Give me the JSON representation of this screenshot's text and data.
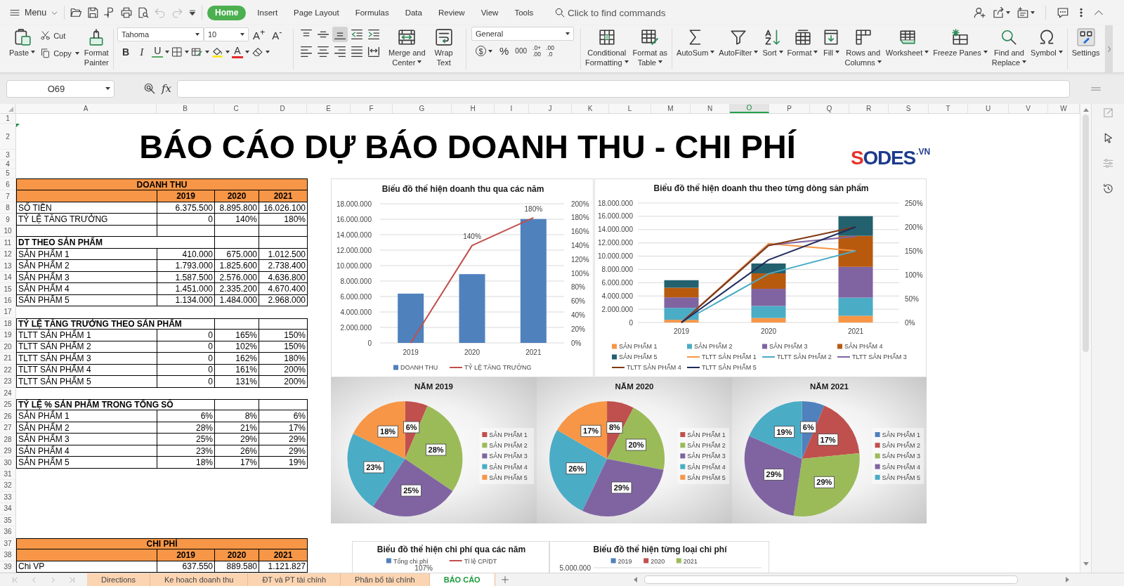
{
  "title_bar": {
    "menu": {
      "label": "Menu"
    },
    "quick_access": [
      {
        "disabled": false
      },
      {
        "disabled": false
      },
      {
        "disabled": false
      },
      {
        "disabled": false
      },
      {
        "disabled": false
      },
      {
        "disabled": true
      },
      {
        "disabled": true
      }
    ],
    "tabs": [
      {
        "label": "Home",
        "selected": true
      },
      {
        "label": "Insert",
        "selected": false
      },
      {
        "label": "Page Layout",
        "selected": false
      },
      {
        "label": "Formulas",
        "selected": false
      },
      {
        "label": "Data",
        "selected": false
      },
      {
        "label": "Review",
        "selected": false
      },
      {
        "label": "View",
        "selected": false
      },
      {
        "label": "Tools",
        "selected": false
      }
    ],
    "command_search": {
      "placeholder": "Click to find commands"
    }
  },
  "ribbon": {
    "paste": {
      "label": "Paste",
      "dropdown": true
    },
    "cut": {
      "label": "Cut"
    },
    "copy": {
      "label": "Copy",
      "dropdown": true
    },
    "format_painter": {
      "lines": [
        "Format",
        "Painter"
      ]
    },
    "font_name": {
      "value": "Tahoma"
    },
    "font_size": {
      "value": "10"
    },
    "font_grow": "A$^{+}$",
    "font_shrink": "A$^{-}$",
    "bold": "B",
    "italic": "I",
    "underline": "U",
    "font_color": "A",
    "vertical_alignment": [
      {
        "selected": false
      },
      {
        "selected": false
      },
      {
        "selected": true
      }
    ],
    "merge": [
      {
        "lines": [
          "Merge and",
          "Center"
        ],
        "dropdown": true
      },
      {
        "lines": [
          "Wrap",
          "Text"
        ],
        "dropdown": false
      }
    ],
    "number_format": {
      "value": "General"
    },
    "currency": "$",
    "percent": "%",
    "thousands": "000",
    "increase_decimal": [
      ".0+",
      ".00"
    ],
    "decrease_decimal": [
      ".00",
      ".0"
    ],
    "tools": [
      {
        "lines": [
          "Conditional",
          "Formatting"
        ],
        "dropdown": true
      },
      {
        "lines": [
          "Format as",
          "Table"
        ],
        "dropdown": true
      },
      {
        "lines": [
          "AutoSum"
        ],
        "dropdown": true
      },
      {
        "lines": [
          "AutoFilter"
        ],
        "dropdown": true
      },
      {
        "lines": [
          "Sort"
        ],
        "dropdown": true
      },
      {
        "lines": [
          "Format"
        ],
        "dropdown": true
      },
      {
        "lines": [
          "Fill"
        ],
        "dropdown": true
      },
      {
        "lines": [
          "Rows and",
          "Columns"
        ],
        "dropdown": true
      },
      {
        "lines": [
          "Worksheet"
        ],
        "dropdown": true
      },
      {
        "lines": [
          "Freeze Panes"
        ],
        "dropdown": true
      },
      {
        "lines": [
          "Find and",
          "Replace"
        ],
        "dropdown": true
      },
      {
        "lines": [
          "Symbol"
        ],
        "dropdown": true
      },
      {
        "lines": [
          "Settings"
        ],
        "dropdown": false
      }
    ]
  },
  "formula_bar": {
    "name_box": "O69",
    "function_label": "fx"
  },
  "column_headers": [
    {
      "label": "A",
      "selected": false
    },
    {
      "label": "B",
      "selected": false
    },
    {
      "label": "C",
      "selected": false
    },
    {
      "label": "D",
      "selected": false
    },
    {
      "label": "E",
      "selected": false
    },
    {
      "label": "F",
      "selected": false
    },
    {
      "label": "G",
      "selected": false
    },
    {
      "label": "H",
      "selected": false
    },
    {
      "label": "I",
      "selected": false
    },
    {
      "label": "J",
      "selected": false
    },
    {
      "label": "K",
      "selected": false
    },
    {
      "label": "L",
      "selected": false
    },
    {
      "label": "M",
      "selected": false
    },
    {
      "label": "N",
      "selected": false
    },
    {
      "label": "O",
      "selected": true
    },
    {
      "label": "P",
      "selected": false
    },
    {
      "label": "Q",
      "selected": false
    },
    {
      "label": "R",
      "selected": false
    },
    {
      "label": "S",
      "selected": false
    },
    {
      "label": "T",
      "selected": false
    },
    {
      "label": "U",
      "selected": false
    },
    {
      "label": "V",
      "selected": false
    },
    {
      "label": "W",
      "selected": false
    }
  ],
  "row_numbers": [
    "1",
    "2",
    "3",
    "4",
    "5",
    "6",
    "7",
    "8",
    "9",
    "10",
    "11",
    "12",
    "13",
    "14",
    "15",
    "16",
    "17",
    "18",
    "19",
    "20",
    "21",
    "22",
    "23",
    "24",
    "25",
    "26",
    "27",
    "28",
    "29",
    "30",
    "31",
    "32",
    "33",
    "34",
    "35",
    "36",
    "37",
    "38",
    "39"
  ],
  "sheet": {
    "title": "BÁO CÁO DỰ BÁO DOANH THU - CHI PHÍ",
    "logo": {
      "mark": "S",
      "name": "ODES",
      "suffix": ".VN"
    },
    "rows": [
      {
        "kind": "band",
        "label": "DOANH THU"
      },
      {
        "kind": "years",
        "values": [
          "2019",
          "2020",
          "2021"
        ]
      },
      {
        "kind": "data",
        "label": "SỐ TIỀN",
        "values": [
          "6.375.500",
          "8.895.800",
          "16.026.100"
        ]
      },
      {
        "kind": "data",
        "label": "TỶ LỆ TĂNG TRƯỞNG",
        "values": [
          "0",
          "140%",
          "180%"
        ]
      },
      {
        "kind": "empty"
      },
      {
        "kind": "section",
        "label": "DT THEO SẢN PHẨM"
      },
      {
        "kind": "data",
        "label": "SẢN PHẨM 1",
        "values": [
          "410.000",
          "675.000",
          "1.012.500"
        ]
      },
      {
        "kind": "data",
        "label": "SẢN PHẨM 2",
        "values": [
          "1.793.000",
          "1.825.600",
          "2.738.400"
        ]
      },
      {
        "kind": "data",
        "label": "SẢN PHẨM 3",
        "values": [
          "1.587.500",
          "2.576.000",
          "4.636.800"
        ]
      },
      {
        "kind": "data",
        "label": "SẢN PHẨM 4",
        "values": [
          "1.451.000",
          "2.335.200",
          "4.670.400"
        ]
      },
      {
        "kind": "data",
        "label": "SẢN PHẨM 5",
        "values": [
          "1.134.000",
          "1.484.000",
          "2.968.000"
        ]
      },
      {
        "kind": "gap"
      },
      {
        "kind": "section",
        "label": "TỶ LỆ TĂNG TRƯỞNG THEO SẢN PHẨM"
      },
      {
        "kind": "data",
        "label": "TLTT SẢN PHẨM 1",
        "values": [
          "0",
          "165%",
          "150%"
        ]
      },
      {
        "kind": "data",
        "label": "TLTT SẢN PHẨM 2",
        "values": [
          "0",
          "102%",
          "150%"
        ]
      },
      {
        "kind": "data",
        "label": "TLTT SẢN PHẨM 3",
        "values": [
          "0",
          "162%",
          "180%"
        ]
      },
      {
        "kind": "data",
        "label": "TLTT SẢN PHẨM 4",
        "values": [
          "0",
          "161%",
          "200%"
        ]
      },
      {
        "kind": "data",
        "label": "TLTT SẢN PHẨM 5",
        "values": [
          "0",
          "131%",
          "200%"
        ]
      },
      {
        "kind": "gap"
      },
      {
        "kind": "section",
        "label": "TỶ LỆ % SẢN PHẨM TRONG TỔNG SỐ"
      },
      {
        "kind": "data",
        "label": "SẢN PHẨM 1",
        "values": [
          "6%",
          "8%",
          "6%"
        ]
      },
      {
        "kind": "data",
        "label": "SẢN PHẨM 2",
        "values": [
          "28%",
          "21%",
          "17%"
        ]
      },
      {
        "kind": "data",
        "label": "SẢN PHẨM 3",
        "values": [
          "25%",
          "29%",
          "29%"
        ]
      },
      {
        "kind": "data",
        "label": "SẢN PHẨM 4",
        "values": [
          "23%",
          "26%",
          "29%"
        ]
      },
      {
        "kind": "data",
        "label": "SẢN PHẨM 5",
        "values": [
          "18%",
          "17%",
          "19%"
        ]
      },
      {
        "kind": "gap"
      },
      {
        "kind": "gap"
      },
      {
        "kind": "gap"
      },
      {
        "kind": "gap"
      },
      {
        "kind": "gap"
      },
      {
        "kind": "gap"
      },
      {
        "kind": "band",
        "label": "CHI PHÍ"
      },
      {
        "kind": "years",
        "values": [
          "2019",
          "2020",
          "2021"
        ]
      },
      {
        "kind": "data",
        "label": "Chi VP",
        "values": [
          "637.550",
          "889.580",
          "1.121.827"
        ]
      }
    ]
  },
  "charts": [
    {
      "chart_data": {
        "type": "bar",
        "title": "Biểu đồ thể hiện doanh thu qua các năm",
        "legend": "bottom",
        "grid": true,
        "categories": [
          "2019",
          "2020",
          "2021"
        ],
        "series": [
          {
            "name": "DOANH THU",
            "color": "#4f81bd",
            "values": [
              6375500,
              8895800,
              16026100
            ]
          },
          {
            "name": "TỶ LỆ TĂNG TRƯỞNG",
            "color": "#c0504d",
            "type": "line",
            "axis": "y2",
            "values": [
              0,
              140,
              180
            ]
          }
        ],
        "ylim": [
          0,
          18000000
        ],
        "yticks": [
          {
            "value": 0,
            "label": "0"
          },
          {
            "value": 2000000,
            "label": "2.000.000"
          },
          {
            "value": 4000000,
            "label": "4.000.000"
          },
          {
            "value": 6000000,
            "label": "6.000.000"
          },
          {
            "value": 8000000,
            "label": "8.000.000"
          },
          {
            "value": 10000000,
            "label": "10.000.000"
          },
          {
            "value": 12000000,
            "label": "12.000.000"
          },
          {
            "value": 14000000,
            "label": "14.000.000"
          },
          {
            "value": 16000000,
            "label": "16.000.000"
          },
          {
            "value": 18000000,
            "label": "18.000.000"
          }
        ],
        "y2lim": [
          0,
          200
        ],
        "y2ticks": [
          {
            "value": 0,
            "label": "0%"
          },
          {
            "value": 20,
            "label": "20%"
          },
          {
            "value": 40,
            "label": "40%"
          },
          {
            "value": 60,
            "label": "60%"
          },
          {
            "value": 80,
            "label": "80%"
          },
          {
            "value": 100,
            "label": "100%"
          },
          {
            "value": 120,
            "label": "120%"
          },
          {
            "value": 140,
            "label": "140%"
          },
          {
            "value": 160,
            "label": "160%"
          },
          {
            "value": 180,
            "label": "180%"
          },
          {
            "value": 200,
            "label": "200%"
          }
        ],
        "annotations": [
          "140%",
          "180%"
        ]
      }
    },
    {
      "chart_data": {
        "type": "bar",
        "title": "Biểu đồ thể hiện doanh thu theo từng dòng sản phẩm",
        "legend": "bottom",
        "grid": true,
        "stacked": true,
        "categories": [
          "2019",
          "2020",
          "2021"
        ],
        "series": [
          {
            "name": "SẢN PHẨM 1",
            "color": "#f79646",
            "values": [
              410000,
              675000,
              1012500
            ]
          },
          {
            "name": "SẢN PHẨM 2",
            "color": "#4bacc6",
            "values": [
              1793000,
              1825600,
              2738400
            ]
          },
          {
            "name": "SẢN PHẨM 3",
            "color": "#8064a2",
            "values": [
              1587500,
              2576000,
              4636800
            ]
          },
          {
            "name": "SẢN PHẨM 4",
            "color": "#b85a0e",
            "values": [
              1451000,
              2335200,
              4670400
            ]
          },
          {
            "name": "SẢN PHẨM 5",
            "color": "#23616f",
            "values": [
              1134000,
              1484000,
              2968000
            ]
          },
          {
            "name": "TLTT SẢN PHẨM 1",
            "color": "#f79646",
            "type": "line",
            "axis": "y2",
            "values": [
              0,
              165,
              150
            ]
          },
          {
            "name": "TLTT SẢN PHẨM 2",
            "color": "#4bacc6",
            "type": "line",
            "axis": "y2",
            "values": [
              0,
              102,
              150
            ]
          },
          {
            "name": "TLTT SẢN PHẨM 3",
            "color": "#8064a2",
            "type": "line",
            "axis": "y2",
            "values": [
              0,
              162,
              180
            ]
          },
          {
            "name": "TLTT SẢN PHẨM 4",
            "color": "#7f3a12",
            "type": "line",
            "axis": "y2",
            "values": [
              0,
              161,
              200
            ]
          },
          {
            "name": "TLTT SẢN PHẨM 5",
            "color": "#1f2b5c",
            "type": "line",
            "axis": "y2",
            "values": [
              0,
              131,
              200
            ]
          }
        ],
        "ylim": [
          0,
          18000000
        ],
        "yticks": [
          {
            "value": 0,
            "label": "0"
          },
          {
            "value": 2000000,
            "label": "2.000.000"
          },
          {
            "value": 4000000,
            "label": "4.000.000"
          },
          {
            "value": 6000000,
            "label": "6.000.000"
          },
          {
            "value": 8000000,
            "label": "8.000.000"
          },
          {
            "value": 10000000,
            "label": "10.000.000"
          },
          {
            "value": 12000000,
            "label": "12.000.000"
          },
          {
            "value": 14000000,
            "label": "14.000.000"
          },
          {
            "value": 16000000,
            "label": "16.000.000"
          },
          {
            "value": 18000000,
            "label": "18.000.000"
          }
        ],
        "y2lim": [
          0,
          250
        ],
        "y2ticks": [
          {
            "value": 0,
            "label": "0%"
          },
          {
            "value": 50,
            "label": "50%"
          },
          {
            "value": 100,
            "label": "100%"
          },
          {
            "value": 150,
            "label": "150%"
          },
          {
            "value": 200,
            "label": "200%"
          },
          {
            "value": 250,
            "label": "250%"
          }
        ]
      }
    }
  ],
  "pie_charts": [
    {
      "chart_data": {
        "type": "pie",
        "title": "NĂM 2019",
        "legend": "right",
        "categories": [
          "SẢN PHẨM 1",
          "SẢN PHẨM 2",
          "SẢN PHẨM 3",
          "SẢN PHẨM 4",
          "SẢN PHẨM 5"
        ],
        "values": [
          6.4,
          28.1,
          24.9,
          22.8,
          17.8
        ],
        "colors": [
          "#c0504d",
          "#9bbb59",
          "#8064a2",
          "#4bacc6",
          "#f79646"
        ],
        "value_labels": [
          "6%",
          "28%",
          "25%",
          "23%",
          "18%"
        ]
      }
    },
    {
      "chart_data": {
        "type": "pie",
        "title": "NĂM 2020",
        "legend": "right",
        "categories": [
          "SẢN PHẨM 1",
          "SẢN PHẨM 2",
          "SẢN PHẨM 3",
          "SẢN PHẨM 4",
          "SẢN PHẨM 5"
        ],
        "values": [
          7.6,
          20.5,
          29.0,
          26.3,
          16.7
        ],
        "colors": [
          "#c0504d",
          "#9bbb59",
          "#8064a2",
          "#4bacc6",
          "#f79646"
        ],
        "value_labels": [
          "8%",
          "20%",
          "29%",
          "26%",
          "17%"
        ]
      }
    },
    {
      "chart_data": {
        "type": "pie",
        "title": "NĂM 2021",
        "legend": "right",
        "categories": [
          "SẢN PHẨM 1",
          "SẢN PHẨM 2",
          "SẢN PHẨM 3",
          "SẢN PHẨM 4",
          "SẢN PHẨM 5"
        ],
        "values": [
          6.3,
          17.1,
          28.9,
          29.1,
          18.5
        ],
        "colors": [
          "#4f81bd",
          "#c0504d",
          "#9bbb59",
          "#8064a2",
          "#4bacc6"
        ],
        "value_labels": [
          "6%",
          "17%",
          "29%",
          "29%",
          "19%"
        ]
      }
    }
  ],
  "cost_charts": [
    {
      "title": "Biểu đồ thể hiện chi phí qua các năm",
      "legend": [
        {
          "label": "Tổng chi phí",
          "color": "#4f81bd",
          "kind": "bar"
        },
        {
          "label": "Tỉ lệ CP/DT",
          "color": "#c0504d",
          "kind": "line"
        }
      ],
      "labels": [
        {
          "text": "107%",
          "kind": "data_label"
        }
      ]
    },
    {
      "title": "Biểu đồ thể hiện từng loại chi phí",
      "legend": [
        {
          "label": "2019",
          "color": "#4f81bd",
          "kind": "bar"
        },
        {
          "label": "2020",
          "color": "#c0504d",
          "kind": "bar"
        },
        {
          "label": "2021",
          "color": "#9bbb59",
          "kind": "bar"
        }
      ],
      "labels": [
        {
          "text": "5.000.000",
          "kind": "axis_label"
        }
      ]
    }
  ],
  "sheet_tabs": [
    {
      "label": "Directions",
      "selected": false
    },
    {
      "label": "Ke hoach doanh thu",
      "selected": false
    },
    {
      "label": "ĐT và PT tài chính",
      "selected": false
    },
    {
      "label": "Phân bổ tài chính",
      "selected": false
    },
    {
      "label": "BÁO CÁO",
      "selected": true
    }
  ]
}
